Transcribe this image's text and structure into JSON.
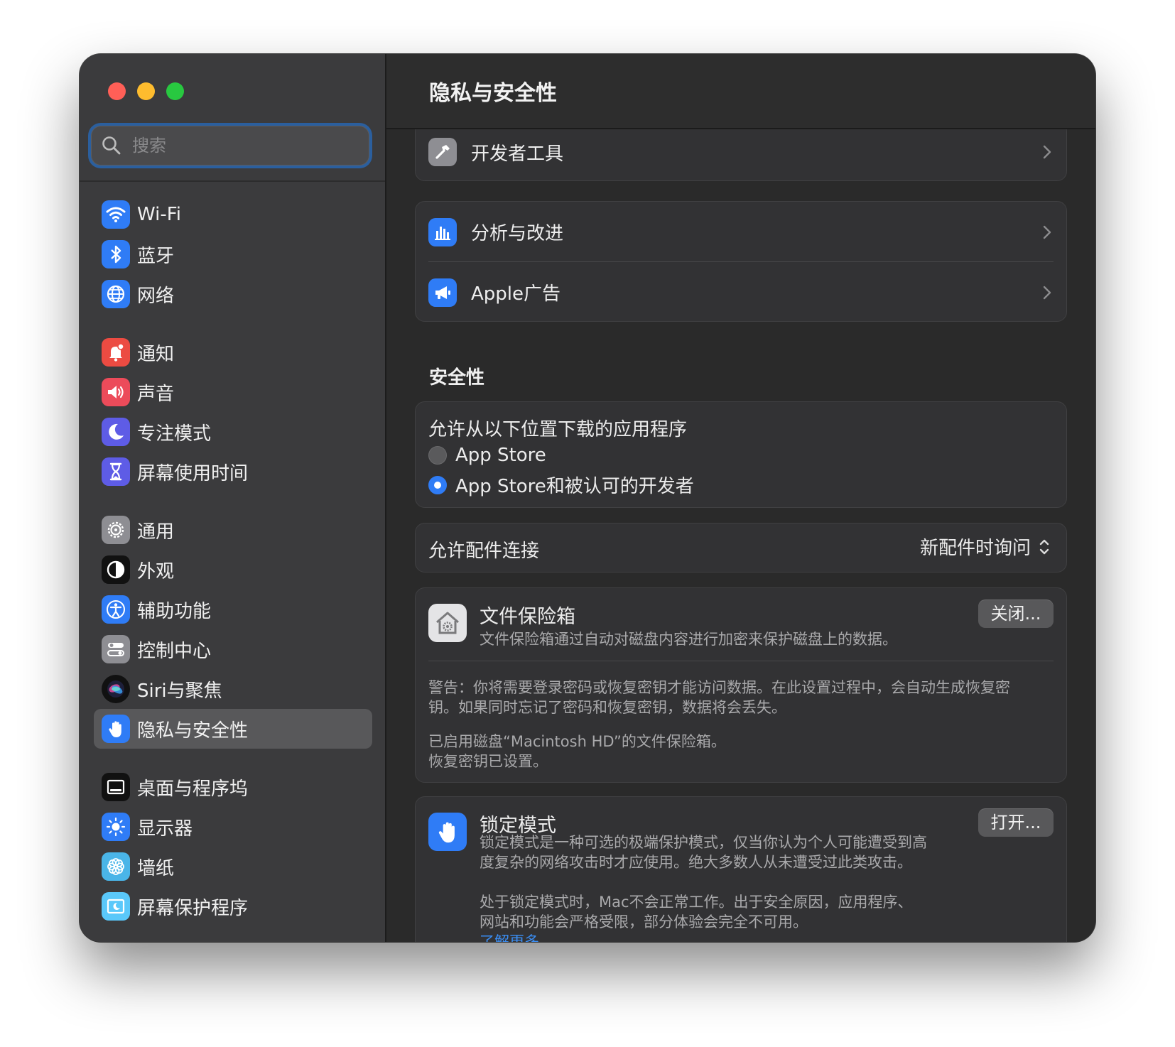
{
  "window": {
    "traffic_lights": {
      "close_color": "#ff5f57",
      "minimize_color": "#febc2e",
      "zoom_color": "#28c840"
    }
  },
  "sidebar": {
    "search": {
      "placeholder": "搜索",
      "value": ""
    },
    "items": [
      {
        "label": "Wi-Fi",
        "icon": "wifi-icon",
        "color": "#2f7cf6"
      },
      {
        "label": "蓝牙",
        "icon": "bluetooth-icon",
        "color": "#2f7cf6"
      },
      {
        "label": "网络",
        "icon": "globe-icon",
        "color": "#2f7cf6"
      },
      {
        "label": "通知",
        "icon": "bell-icon",
        "color": "#ec4b42"
      },
      {
        "label": "声音",
        "icon": "speaker-icon",
        "color": "#ec4b5a"
      },
      {
        "label": "专注模式",
        "icon": "moon-icon",
        "color": "#5e5ce6"
      },
      {
        "label": "屏幕使用时间",
        "icon": "hourglass-icon",
        "color": "#5e5ce6"
      },
      {
        "label": "通用",
        "icon": "gear-icon",
        "color": "#8e8e93"
      },
      {
        "label": "外观",
        "icon": "appearance-icon",
        "color": "#111111"
      },
      {
        "label": "辅助功能",
        "icon": "accessibility-icon",
        "color": "#2f7cf6"
      },
      {
        "label": "控制中心",
        "icon": "control-center-icon",
        "color": "#8e8e93"
      },
      {
        "label": "Siri与聚焦",
        "icon": "siri-icon",
        "color": "#222244"
      },
      {
        "label": "隐私与安全性",
        "icon": "hand-icon",
        "color": "#2f7cf6",
        "selected": true
      },
      {
        "label": "桌面与程序坞",
        "icon": "dock-icon",
        "color": "#111111"
      },
      {
        "label": "显示器",
        "icon": "sun-icon",
        "color": "#2f7cf6"
      },
      {
        "label": "墙纸",
        "icon": "flower-icon",
        "color": "#4ab5e8"
      },
      {
        "label": "屏幕保护程序",
        "icon": "screensaver-icon",
        "color": "#5ac8fa"
      }
    ]
  },
  "main": {
    "title": "隐私与安全性",
    "rows": {
      "developer_tools": "开发者工具",
      "analytics": "分析与改进",
      "apple_ads": "Apple广告"
    },
    "security": {
      "heading": "安全性",
      "allow_apps_label": "允许从以下位置下载的应用程序",
      "options": [
        {
          "label": "App Store",
          "selected": false
        },
        {
          "label": "App Store和被认可的开发者",
          "selected": true
        }
      ],
      "accessory_label": "允许配件连接",
      "accessory_value": "新配件时询问",
      "filevault": {
        "title": "文件保险箱",
        "description": "文件保险箱通过自动对磁盘内容进行加密来保护磁盘上的数据。",
        "button": "关闭...",
        "warning_line1": "警告：你将需要登录密码或恢复密钥才能访问数据。在此设置过程中，会自动生成恢复密",
        "warning_line2": "钥。如果同时忘记了密码和恢复密钥，数据将会丢失。",
        "status_line1": "已启用磁盘“Macintosh HD”的文件保险箱。",
        "status_line2": "恢复密钥已设置。"
      },
      "lockdown": {
        "title": "锁定模式",
        "desc_line1": "锁定模式是一种可选的极端保护模式，仅当你认为个人可能遭受到高",
        "desc_line2": "度复杂的网络攻击时才应使用。绝大多数人从未遭受过此类攻击。",
        "desc_line3": "处于锁定模式时，Mac不会正常工作。出于安全原因，应用程序、",
        "desc_line4": "网站和功能会严格受限，部分体验会完全不可用。",
        "link": "了解更多...",
        "button": "打开..."
      }
    },
    "colors": {
      "accent": "#2f7cf6",
      "link": "#3a8ef5"
    }
  }
}
